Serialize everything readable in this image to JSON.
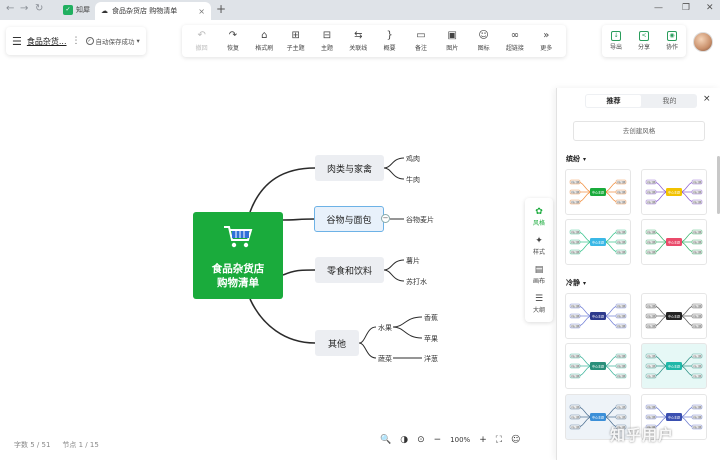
{
  "browser": {
    "nav": [
      "←",
      "→",
      "↻"
    ],
    "app_tab": "知犀",
    "doc_tab": "食品杂货店 购物清单",
    "tab_close": "×",
    "new_tab": "+",
    "window": [
      "—",
      "❐",
      "✕"
    ]
  },
  "header": {
    "menu_icon": "☰",
    "file_name": "食品杂货...",
    "more": "⋮",
    "save_status": "自动保存成功",
    "save_caret": "▾"
  },
  "toolbar": {
    "items": [
      {
        "label": "撤回",
        "icon": "undo-icon",
        "glyph": "↶",
        "disabled": true
      },
      {
        "label": "恢复",
        "icon": "redo-icon",
        "glyph": "↷",
        "disabled": false
      },
      {
        "label": "格式刷",
        "icon": "format-brush-icon",
        "glyph": "⌂",
        "disabled": false
      },
      {
        "label": "子主题",
        "icon": "subtopic-icon",
        "glyph": "⊞",
        "disabled": false
      },
      {
        "label": "主题",
        "icon": "topic-icon",
        "glyph": "⊟",
        "disabled": false
      },
      {
        "label": "关联线",
        "icon": "relation-line-icon",
        "glyph": "⇆",
        "disabled": false
      },
      {
        "label": "概要",
        "icon": "summary-icon",
        "glyph": "}",
        "disabled": false
      },
      {
        "label": "备注",
        "icon": "note-icon",
        "glyph": "▭",
        "disabled": false
      },
      {
        "label": "图片",
        "icon": "image-icon",
        "glyph": "▣",
        "disabled": false
      },
      {
        "label": "图标",
        "icon": "emoji-icon",
        "glyph": "☺",
        "disabled": false
      },
      {
        "label": "超链接",
        "icon": "link-icon",
        "glyph": "∞",
        "disabled": false
      },
      {
        "label": "更多",
        "icon": "more-icon",
        "glyph": "»",
        "disabled": false
      }
    ]
  },
  "right_tools": [
    {
      "label": "导出",
      "icon": "export-icon",
      "glyph": "↓"
    },
    {
      "label": "分享",
      "icon": "share-icon",
      "glyph": "<"
    },
    {
      "label": "协作",
      "icon": "collaborate-icon",
      "glyph": "◉"
    }
  ],
  "mindmap": {
    "root": "食品杂货店\n购物清单",
    "branches": [
      {
        "label": "肉类与家禽",
        "children": [
          "鸡肉",
          "牛肉"
        ]
      },
      {
        "label": "谷物与面包",
        "children": [
          "谷物麦片"
        ],
        "selected": true,
        "collapse": "−"
      },
      {
        "label": "零食和饮料",
        "children": [
          "薯片",
          "苏打水"
        ]
      },
      {
        "label": "其他",
        "children": [
          {
            "label": "水果",
            "children": [
              "香蕉",
              "苹果"
            ]
          },
          {
            "label": "蔬菜",
            "children": [
              "洋葱"
            ]
          }
        ]
      }
    ]
  },
  "status": {
    "words": "字数 5 / 51",
    "nodes": "节点 1 / 15"
  },
  "zoom": {
    "level": "100%",
    "minus": "−",
    "plus": "+",
    "icons": [
      "🔍",
      "◑",
      "⊙",
      "⛶",
      "☺"
    ]
  },
  "side_strip": [
    {
      "label": "风格",
      "icon": "palette-icon",
      "glyph": "✿",
      "active": true
    },
    {
      "label": "样式",
      "icon": "style-icon",
      "glyph": "✦",
      "active": false
    },
    {
      "label": "画布",
      "icon": "canvas-icon",
      "glyph": "▤",
      "active": false
    },
    {
      "label": "大纲",
      "icon": "outline-icon",
      "glyph": "☰",
      "active": false
    }
  ],
  "panel": {
    "tabs": [
      {
        "label": "推荐",
        "active": true
      },
      {
        "label": "我的",
        "active": false
      }
    ],
    "close": "×",
    "create_label": "去创建风格",
    "sections": [
      {
        "label": "缤纷",
        "caret": "▾"
      },
      {
        "label": "冷静",
        "caret": "▾"
      }
    ],
    "thumb_center_label": "中心主题",
    "thumb_leaf_label": "分支主题"
  },
  "watermark": "知乎用户",
  "colors": {
    "accent": "#1aab3c",
    "selected_border": "#6db2e6",
    "branch_line": "#2b2b2b"
  }
}
